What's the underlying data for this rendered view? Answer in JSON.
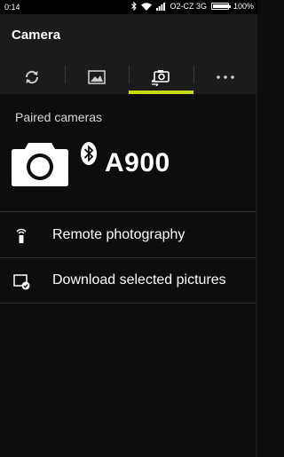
{
  "status_bar": {
    "time": "0:14",
    "carrier": "O2-CZ 3G",
    "battery": "100%",
    "battery_level": 1.0,
    "icons": [
      "bluetooth-icon",
      "wifi-icon",
      "signal-icon",
      "battery-icon"
    ]
  },
  "app_bar": {
    "title": "Camera"
  },
  "tabs": [
    {
      "icon": "sync-icon",
      "selected": false
    },
    {
      "icon": "gallery-icon",
      "selected": false
    },
    {
      "icon": "camera-transfer-icon",
      "selected": true
    },
    {
      "icon": "more-icon",
      "selected": false
    }
  ],
  "paired": {
    "label": "Paired cameras",
    "camera_icon": "camera-icon",
    "connection_icon": "bluetooth-icon",
    "model": "A900"
  },
  "menu": [
    {
      "icon": "remote-control-icon",
      "label": "Remote photography"
    },
    {
      "icon": "download-picture-icon",
      "label": "Download selected pictures"
    }
  ],
  "colors": {
    "background": "#0d0d0d",
    "bar": "#1b1b1b",
    "accent": "#c8dc14",
    "divider": "#333333"
  }
}
